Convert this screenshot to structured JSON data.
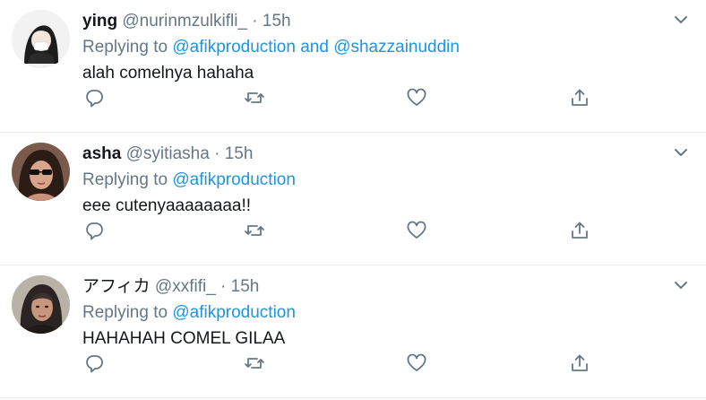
{
  "tweets": [
    {
      "name": "ying",
      "handle": "@nurinmzulkifli_",
      "dot": "·",
      "time": "15h",
      "replying_prefix": "Replying to",
      "mentions": [
        "@afikproduction",
        "@shazzainuddin"
      ],
      "mention_joiner": "and",
      "text": "alah comelnya hahaha"
    },
    {
      "name": "asha",
      "handle": "@syitiasha",
      "dot": "·",
      "time": "15h",
      "replying_prefix": "Replying to",
      "mentions": [
        "@afikproduction"
      ],
      "text": "eee cutenyaaaaaaaa!!"
    },
    {
      "name": "アフィカ",
      "handle": "@xxfifi_",
      "dot": "·",
      "time": "15h",
      "replying_prefix": "Replying to",
      "mentions": [
        "@afikproduction"
      ],
      "text": "HAHAHAH COMEL GILAA"
    }
  ],
  "icons": {
    "reply": "reply-icon",
    "retweet": "retweet-icon",
    "like": "heart-icon",
    "share": "share-icon",
    "more": "chevron-down-icon"
  },
  "colors": {
    "text": "#14171a",
    "muted": "#657786",
    "link": "#1b95e0",
    "divider": "#e6ecf0"
  }
}
